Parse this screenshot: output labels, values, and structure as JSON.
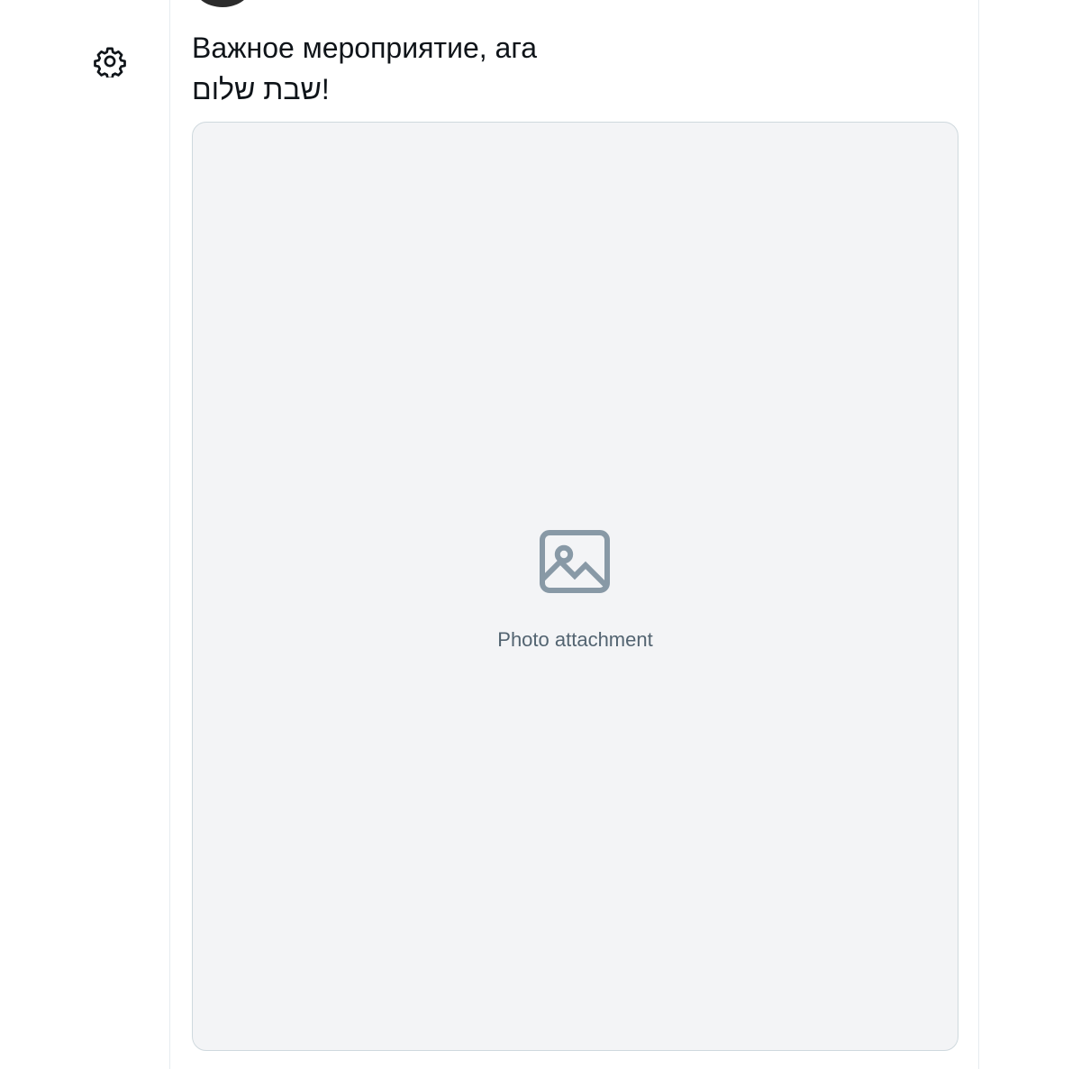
{
  "sidebar": {
    "settings_icon": "gear-icon"
  },
  "tweet": {
    "text_lines": [
      "Важное мероприятие, ага",
      "!שבת שלום"
    ],
    "media": {
      "placeholder_icon": "image-icon",
      "note": "Photo attachment"
    }
  }
}
